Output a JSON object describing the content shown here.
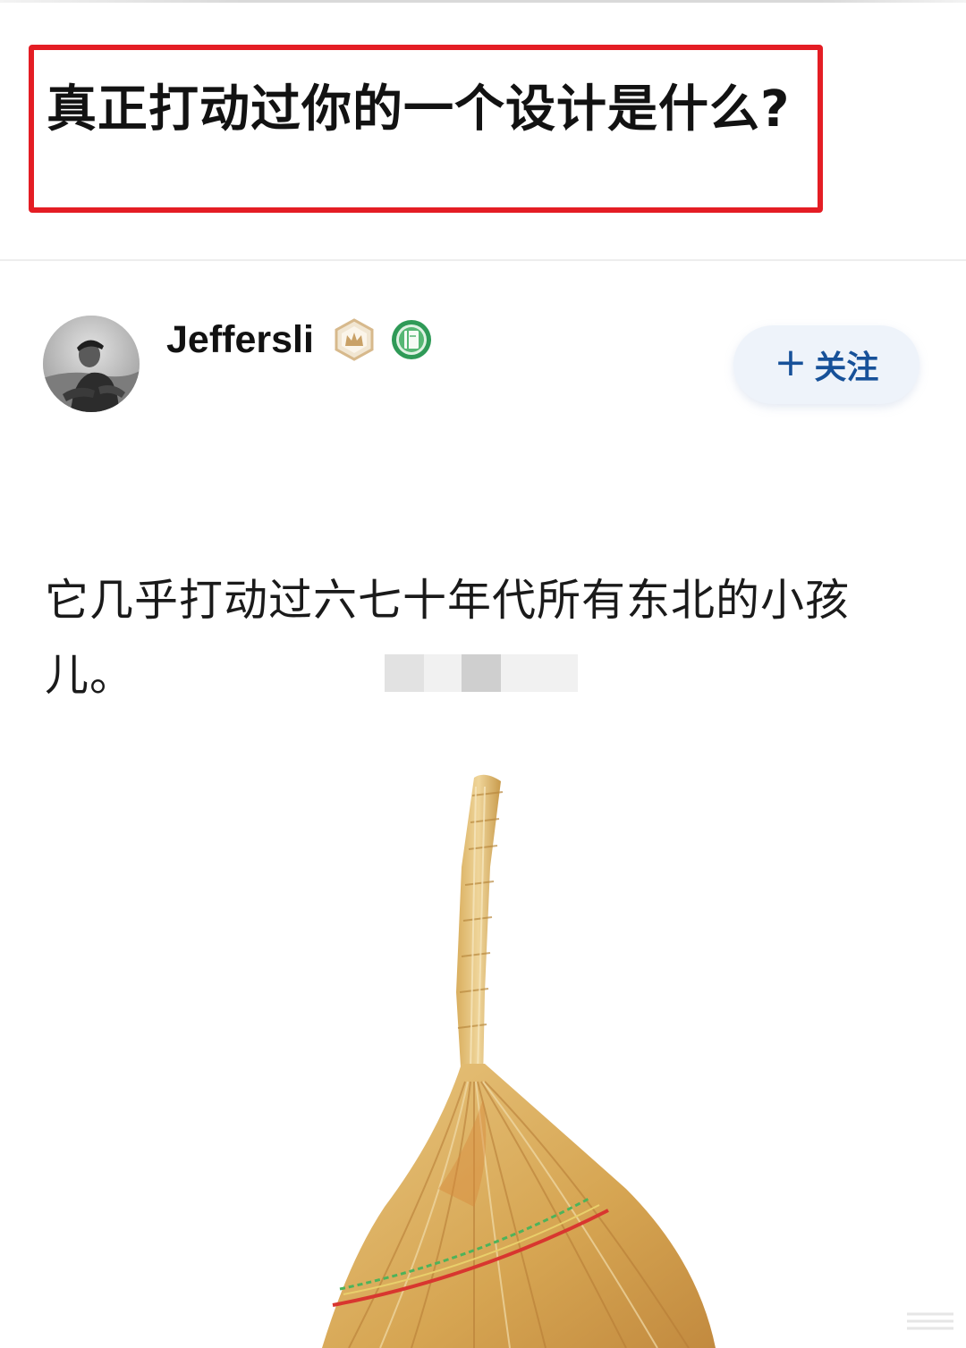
{
  "question": {
    "title": "真正打动过你的一个设计是什么?"
  },
  "author": {
    "name": "Jeffersli",
    "avatar_icon": "person-photo-avatar",
    "badges": [
      "crown-badge-icon",
      "book-badge-icon"
    ]
  },
  "follow_button": {
    "plus": "+",
    "label": "关注"
  },
  "answer": {
    "text": "它几乎打动过六七十年代所有东北的小孩儿。",
    "image_icon": "broom-image"
  },
  "colors": {
    "highlight_border": "#e41d24",
    "follow_text": "#175199",
    "follow_bg": "#eef3fa"
  }
}
